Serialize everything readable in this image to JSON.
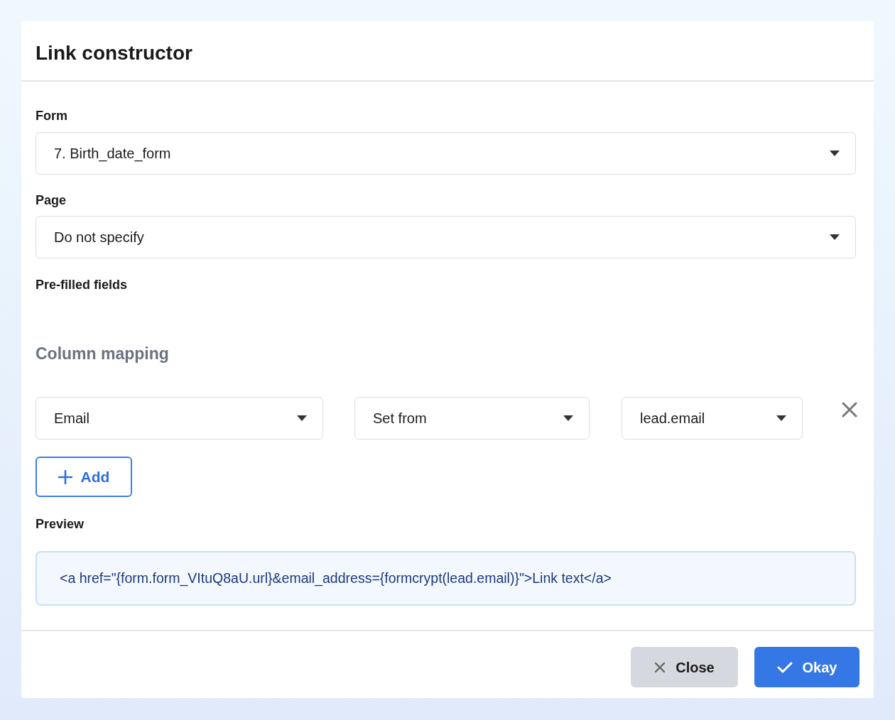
{
  "dialog": {
    "title": "Link constructor"
  },
  "form_field": {
    "label": "Form",
    "value": "7. Birth_date_form"
  },
  "page_field": {
    "label": "Page",
    "value": "Do not specify"
  },
  "prefilled": {
    "label": "Pre-filled fields"
  },
  "column_mapping": {
    "title": "Column mapping",
    "rows": [
      {
        "field": "Email",
        "mode": "Set from",
        "source": "lead.email"
      }
    ],
    "add_button": "Add"
  },
  "preview": {
    "label": "Preview",
    "code": "<a href=\"{form.form_VItuQ8aU.url}&email_address={formcrypt(lead.email)}\">Link text</a>"
  },
  "buttons": [
    {
      "kind": "secondary",
      "label": "Close"
    },
    {
      "kind": "primary",
      "label": "Okay"
    }
  ]
}
